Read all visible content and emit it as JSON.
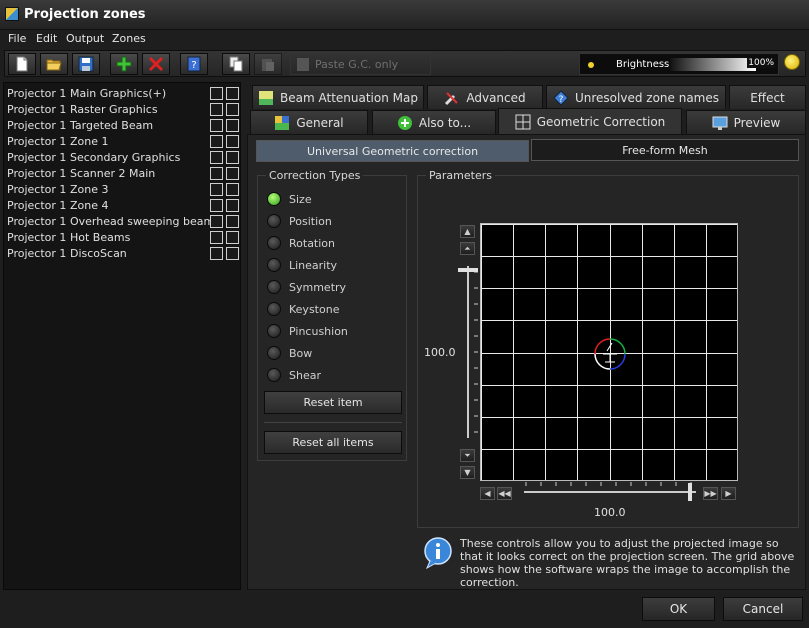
{
  "window": {
    "title": "Projection zones"
  },
  "menu": [
    "File",
    "Edit",
    "Output",
    "Zones"
  ],
  "toolbar": {
    "buttons": [
      "new-file-icon",
      "open-folder-icon",
      "save-icon",
      "add-icon",
      "delete-icon",
      "help-icon",
      "copy-icon",
      "paste-icon"
    ],
    "paste_gc_label": "Paste G.C. only",
    "brightness_label": "Brightness",
    "brightness_value": "100%",
    "brightness_level": 1.0
  },
  "zones": [
    {
      "projector": "Projector 1",
      "name": "Main Graphics(+)"
    },
    {
      "projector": "Projector 1",
      "name": "Raster Graphics"
    },
    {
      "projector": "Projector 1",
      "name": "Targeted Beam"
    },
    {
      "projector": "Projector 1",
      "name": "Zone 1"
    },
    {
      "projector": "Projector 1",
      "name": "Secondary Graphics"
    },
    {
      "projector": "Projector 1",
      "name": "Scanner 2 Main"
    },
    {
      "projector": "Projector 1",
      "name": "Zone 3"
    },
    {
      "projector": "Projector 1",
      "name": "Zone 4"
    },
    {
      "projector": "Projector 1",
      "name": "Overhead sweeping beams"
    },
    {
      "projector": "Projector 1",
      "name": "Hot Beams"
    },
    {
      "projector": "Projector 1",
      "name": "DiscoScan"
    }
  ],
  "tabs_row1": [
    {
      "label": "Beam Attenuation Map",
      "icon": "beam-attenuation-icon"
    },
    {
      "label": "Advanced",
      "icon": "tools-icon"
    },
    {
      "label": "Unresolved zone names",
      "icon": "question-icon"
    },
    {
      "label": "Effect",
      "icon": ""
    }
  ],
  "tabs_row2": [
    {
      "label": "General",
      "icon": "general-icon"
    },
    {
      "label": "Also to...",
      "icon": "plus-circle-icon"
    },
    {
      "label": "Geometric Correction",
      "icon": "grid-icon"
    },
    {
      "label": "Preview",
      "icon": "monitor-icon"
    }
  ],
  "subtabs": {
    "universal": "Universal Geometric correction",
    "freeform": "Free-form Mesh"
  },
  "correction": {
    "group_label": "Correction Types",
    "types": [
      "Size",
      "Position",
      "Rotation",
      "Linearity",
      "Symmetry",
      "Keystone",
      "Pincushion",
      "Bow",
      "Shear"
    ],
    "selected": "Size",
    "reset_item": "Reset item",
    "reset_all": "Reset all items"
  },
  "parameters": {
    "group_label": "Parameters",
    "vertical_value": "100.0",
    "horizontal_value": "100.0"
  },
  "info_text": "These controls allow you to adjust the projected image so that it looks correct on the projection screen. The grid above shows how the software wraps the image to accomplish the correction.",
  "footer": {
    "ok": "OK",
    "cancel": "Cancel"
  }
}
